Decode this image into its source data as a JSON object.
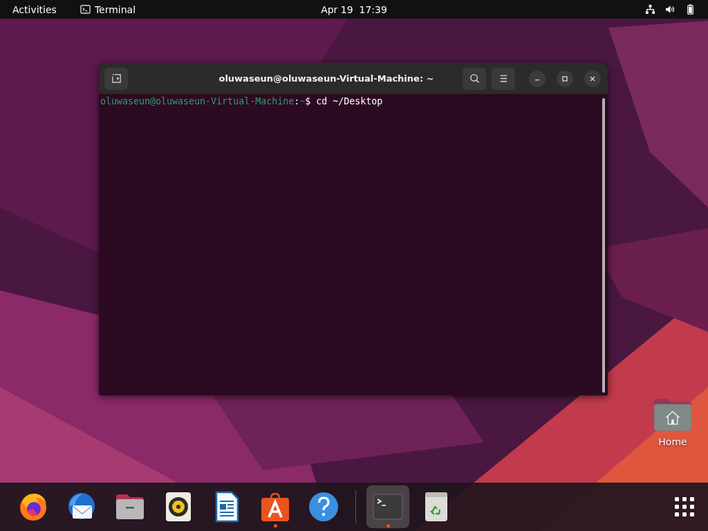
{
  "top_bar": {
    "activities": "Activities",
    "app_menu": "Terminal",
    "clock": "Apr 19  17:39"
  },
  "terminal_window": {
    "title": "oluwaseun@oluwaseun-Virtual-Machine: ~",
    "lines": [
      {
        "user_host": "oluwaseun@oluwaseun-Virtual-Machine",
        "separator": ":",
        "path": "~",
        "prompt": "$",
        "command": "cd ~/Desktop"
      }
    ]
  },
  "desktop_icons": [
    {
      "label": "Home"
    }
  ],
  "dock": {
    "apps": [
      {
        "kind": "browser",
        "running": false,
        "focused": false
      },
      {
        "kind": "mail",
        "running": false,
        "focused": false
      },
      {
        "kind": "files",
        "running": false,
        "focused": false
      },
      {
        "kind": "music",
        "running": false,
        "focused": false
      },
      {
        "kind": "writer",
        "running": false,
        "focused": false
      },
      {
        "kind": "store",
        "running": true,
        "focused": false
      },
      {
        "kind": "help",
        "running": false,
        "focused": false
      },
      {
        "kind": "separator"
      },
      {
        "kind": "terminal",
        "running": true,
        "focused": true
      },
      {
        "kind": "trash",
        "running": false,
        "focused": false
      }
    ]
  }
}
